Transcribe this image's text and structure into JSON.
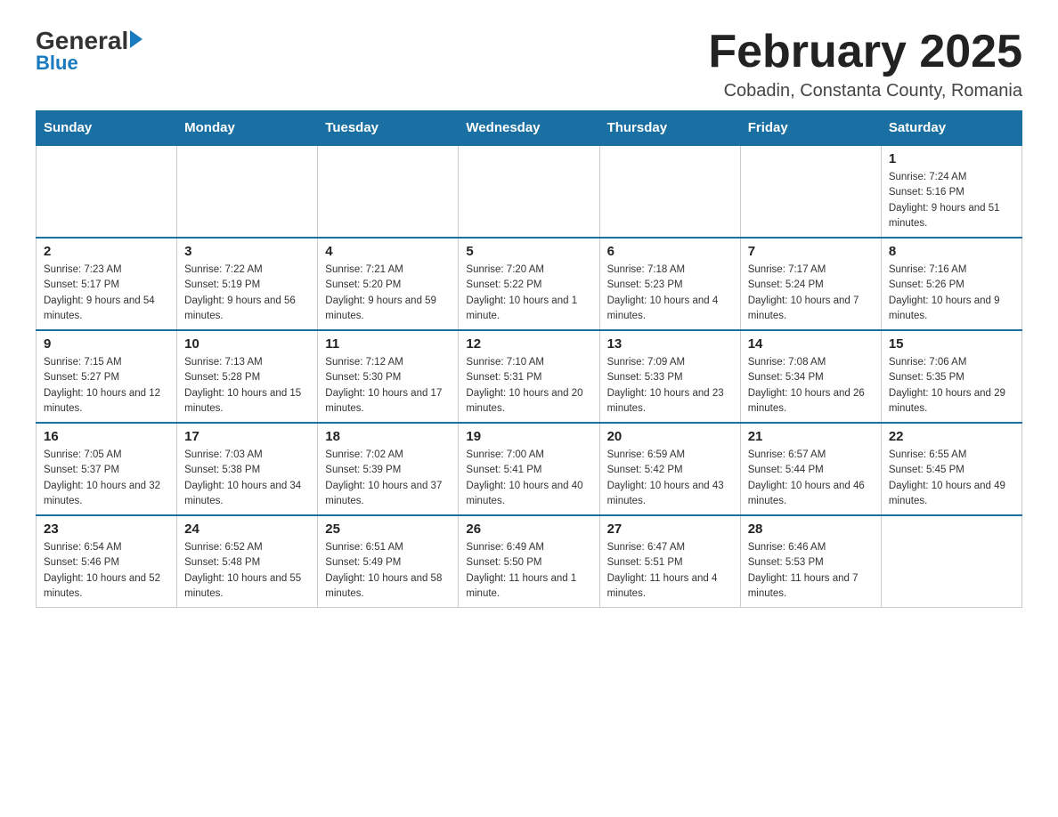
{
  "logo": {
    "text_general": "General",
    "text_blue": "Blue"
  },
  "header": {
    "title": "February 2025",
    "subtitle": "Cobadin, Constanta County, Romania"
  },
  "weekdays": [
    "Sunday",
    "Monday",
    "Tuesday",
    "Wednesday",
    "Thursday",
    "Friday",
    "Saturday"
  ],
  "weeks": [
    [
      {
        "day": "",
        "sunrise": "",
        "sunset": "",
        "daylight": ""
      },
      {
        "day": "",
        "sunrise": "",
        "sunset": "",
        "daylight": ""
      },
      {
        "day": "",
        "sunrise": "",
        "sunset": "",
        "daylight": ""
      },
      {
        "day": "",
        "sunrise": "",
        "sunset": "",
        "daylight": ""
      },
      {
        "day": "",
        "sunrise": "",
        "sunset": "",
        "daylight": ""
      },
      {
        "day": "",
        "sunrise": "",
        "sunset": "",
        "daylight": ""
      },
      {
        "day": "1",
        "sunrise": "Sunrise: 7:24 AM",
        "sunset": "Sunset: 5:16 PM",
        "daylight": "Daylight: 9 hours and 51 minutes."
      }
    ],
    [
      {
        "day": "2",
        "sunrise": "Sunrise: 7:23 AM",
        "sunset": "Sunset: 5:17 PM",
        "daylight": "Daylight: 9 hours and 54 minutes."
      },
      {
        "day": "3",
        "sunrise": "Sunrise: 7:22 AM",
        "sunset": "Sunset: 5:19 PM",
        "daylight": "Daylight: 9 hours and 56 minutes."
      },
      {
        "day": "4",
        "sunrise": "Sunrise: 7:21 AM",
        "sunset": "Sunset: 5:20 PM",
        "daylight": "Daylight: 9 hours and 59 minutes."
      },
      {
        "day": "5",
        "sunrise": "Sunrise: 7:20 AM",
        "sunset": "Sunset: 5:22 PM",
        "daylight": "Daylight: 10 hours and 1 minute."
      },
      {
        "day": "6",
        "sunrise": "Sunrise: 7:18 AM",
        "sunset": "Sunset: 5:23 PM",
        "daylight": "Daylight: 10 hours and 4 minutes."
      },
      {
        "day": "7",
        "sunrise": "Sunrise: 7:17 AM",
        "sunset": "Sunset: 5:24 PM",
        "daylight": "Daylight: 10 hours and 7 minutes."
      },
      {
        "day": "8",
        "sunrise": "Sunrise: 7:16 AM",
        "sunset": "Sunset: 5:26 PM",
        "daylight": "Daylight: 10 hours and 9 minutes."
      }
    ],
    [
      {
        "day": "9",
        "sunrise": "Sunrise: 7:15 AM",
        "sunset": "Sunset: 5:27 PM",
        "daylight": "Daylight: 10 hours and 12 minutes."
      },
      {
        "day": "10",
        "sunrise": "Sunrise: 7:13 AM",
        "sunset": "Sunset: 5:28 PM",
        "daylight": "Daylight: 10 hours and 15 minutes."
      },
      {
        "day": "11",
        "sunrise": "Sunrise: 7:12 AM",
        "sunset": "Sunset: 5:30 PM",
        "daylight": "Daylight: 10 hours and 17 minutes."
      },
      {
        "day": "12",
        "sunrise": "Sunrise: 7:10 AM",
        "sunset": "Sunset: 5:31 PM",
        "daylight": "Daylight: 10 hours and 20 minutes."
      },
      {
        "day": "13",
        "sunrise": "Sunrise: 7:09 AM",
        "sunset": "Sunset: 5:33 PM",
        "daylight": "Daylight: 10 hours and 23 minutes."
      },
      {
        "day": "14",
        "sunrise": "Sunrise: 7:08 AM",
        "sunset": "Sunset: 5:34 PM",
        "daylight": "Daylight: 10 hours and 26 minutes."
      },
      {
        "day": "15",
        "sunrise": "Sunrise: 7:06 AM",
        "sunset": "Sunset: 5:35 PM",
        "daylight": "Daylight: 10 hours and 29 minutes."
      }
    ],
    [
      {
        "day": "16",
        "sunrise": "Sunrise: 7:05 AM",
        "sunset": "Sunset: 5:37 PM",
        "daylight": "Daylight: 10 hours and 32 minutes."
      },
      {
        "day": "17",
        "sunrise": "Sunrise: 7:03 AM",
        "sunset": "Sunset: 5:38 PM",
        "daylight": "Daylight: 10 hours and 34 minutes."
      },
      {
        "day": "18",
        "sunrise": "Sunrise: 7:02 AM",
        "sunset": "Sunset: 5:39 PM",
        "daylight": "Daylight: 10 hours and 37 minutes."
      },
      {
        "day": "19",
        "sunrise": "Sunrise: 7:00 AM",
        "sunset": "Sunset: 5:41 PM",
        "daylight": "Daylight: 10 hours and 40 minutes."
      },
      {
        "day": "20",
        "sunrise": "Sunrise: 6:59 AM",
        "sunset": "Sunset: 5:42 PM",
        "daylight": "Daylight: 10 hours and 43 minutes."
      },
      {
        "day": "21",
        "sunrise": "Sunrise: 6:57 AM",
        "sunset": "Sunset: 5:44 PM",
        "daylight": "Daylight: 10 hours and 46 minutes."
      },
      {
        "day": "22",
        "sunrise": "Sunrise: 6:55 AM",
        "sunset": "Sunset: 5:45 PM",
        "daylight": "Daylight: 10 hours and 49 minutes."
      }
    ],
    [
      {
        "day": "23",
        "sunrise": "Sunrise: 6:54 AM",
        "sunset": "Sunset: 5:46 PM",
        "daylight": "Daylight: 10 hours and 52 minutes."
      },
      {
        "day": "24",
        "sunrise": "Sunrise: 6:52 AM",
        "sunset": "Sunset: 5:48 PM",
        "daylight": "Daylight: 10 hours and 55 minutes."
      },
      {
        "day": "25",
        "sunrise": "Sunrise: 6:51 AM",
        "sunset": "Sunset: 5:49 PM",
        "daylight": "Daylight: 10 hours and 58 minutes."
      },
      {
        "day": "26",
        "sunrise": "Sunrise: 6:49 AM",
        "sunset": "Sunset: 5:50 PM",
        "daylight": "Daylight: 11 hours and 1 minute."
      },
      {
        "day": "27",
        "sunrise": "Sunrise: 6:47 AM",
        "sunset": "Sunset: 5:51 PM",
        "daylight": "Daylight: 11 hours and 4 minutes."
      },
      {
        "day": "28",
        "sunrise": "Sunrise: 6:46 AM",
        "sunset": "Sunset: 5:53 PM",
        "daylight": "Daylight: 11 hours and 7 minutes."
      },
      {
        "day": "",
        "sunrise": "",
        "sunset": "",
        "daylight": ""
      }
    ]
  ]
}
